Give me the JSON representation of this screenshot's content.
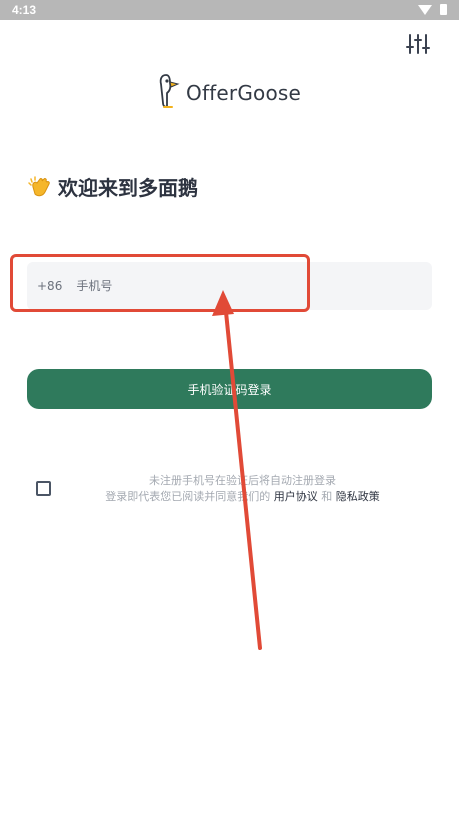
{
  "status_bar": {
    "time": "4:13"
  },
  "icons": {
    "settings": "sliders-icon",
    "logo": "goose-logo-icon",
    "wave": "clapping-hands-icon",
    "wifi": "wifi-icon",
    "battery": "battery-icon"
  },
  "brand": {
    "name": "OfferGoose"
  },
  "welcome": {
    "title": "欢迎来到多面鹅"
  },
  "login": {
    "country_code": "+86",
    "phone_placeholder": "手机号",
    "sms_button_label": "手机验证码登录"
  },
  "agreement": {
    "line1": "未注册手机号在验证后将自动注册登录",
    "line2_prefix": "登录即代表您已阅读并同意我们的",
    "user_agreement": "用户协议",
    "and": "和",
    "privacy_policy": "隐私政策"
  },
  "colors": {
    "primary_button": "#2f7a5c",
    "annotation": "#e14a37",
    "text_dark": "#2d3340",
    "text_muted": "#a4a9b1",
    "input_bg": "#f4f5f7"
  }
}
